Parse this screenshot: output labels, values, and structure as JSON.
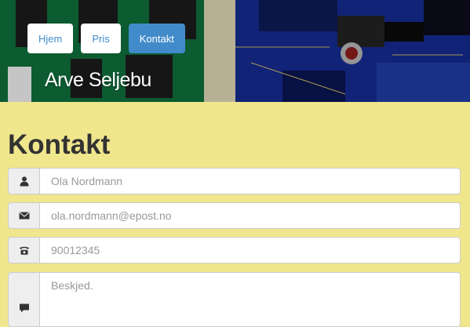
{
  "nav": {
    "items": [
      {
        "label": "Hjem",
        "active": false
      },
      {
        "label": "Pris",
        "active": false
      },
      {
        "label": "Kontakt",
        "active": true
      }
    ]
  },
  "header": {
    "site_title": "Arve Seljebu"
  },
  "main": {
    "page_title": "Kontakt",
    "form": {
      "name_placeholder": "Ola Nordmann",
      "email_placeholder": "ola.nordmann@epost.no",
      "phone_placeholder": "90012345",
      "message_placeholder": "Beskjed.",
      "icons": {
        "name": "user-icon",
        "email": "envelope-icon",
        "phone": "phone-icon",
        "message": "comment-icon"
      }
    }
  },
  "colors": {
    "background": "#f0e68c",
    "accent": "#428bca",
    "text": "#333333"
  }
}
